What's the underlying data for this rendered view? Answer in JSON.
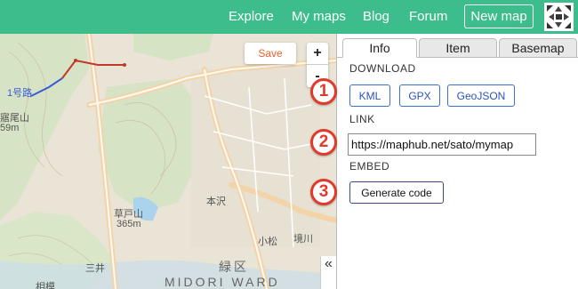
{
  "topbar": {
    "nav": [
      "Explore",
      "My maps",
      "Blog",
      "Forum"
    ],
    "new_map_label": "New map"
  },
  "map": {
    "save_label": "Save",
    "zoom_in": "+",
    "zoom_out": "-",
    "labels": {
      "route": "1号路",
      "mountain1": "寤尾山",
      "elev1": "59m",
      "mountain2": "草戸山",
      "elev2": "365m",
      "ward_kanji": "緑区",
      "ward_en": "MIDORI WARD",
      "river": "本沢",
      "road1": "小松",
      "road2": "境川",
      "road3": "三井",
      "road4": "相模"
    },
    "collapse_icon": "«"
  },
  "panel": {
    "tabs": [
      "Info",
      "Item",
      "Basemap"
    ],
    "active_tab": "Info",
    "download_label": "DOWNLOAD",
    "formats": [
      "KML",
      "GPX",
      "GeoJSON"
    ],
    "link_label": "LINK",
    "link_value": "https://maphub.net/sato/mymap",
    "embed_label": "EMBED",
    "generate_label": "Generate code"
  },
  "markers": [
    "1",
    "2",
    "3"
  ],
  "colors": {
    "brand": "#3cbd8b",
    "save": "#e8622a",
    "marker": "#e23a2a",
    "link": "#2b55b5"
  }
}
